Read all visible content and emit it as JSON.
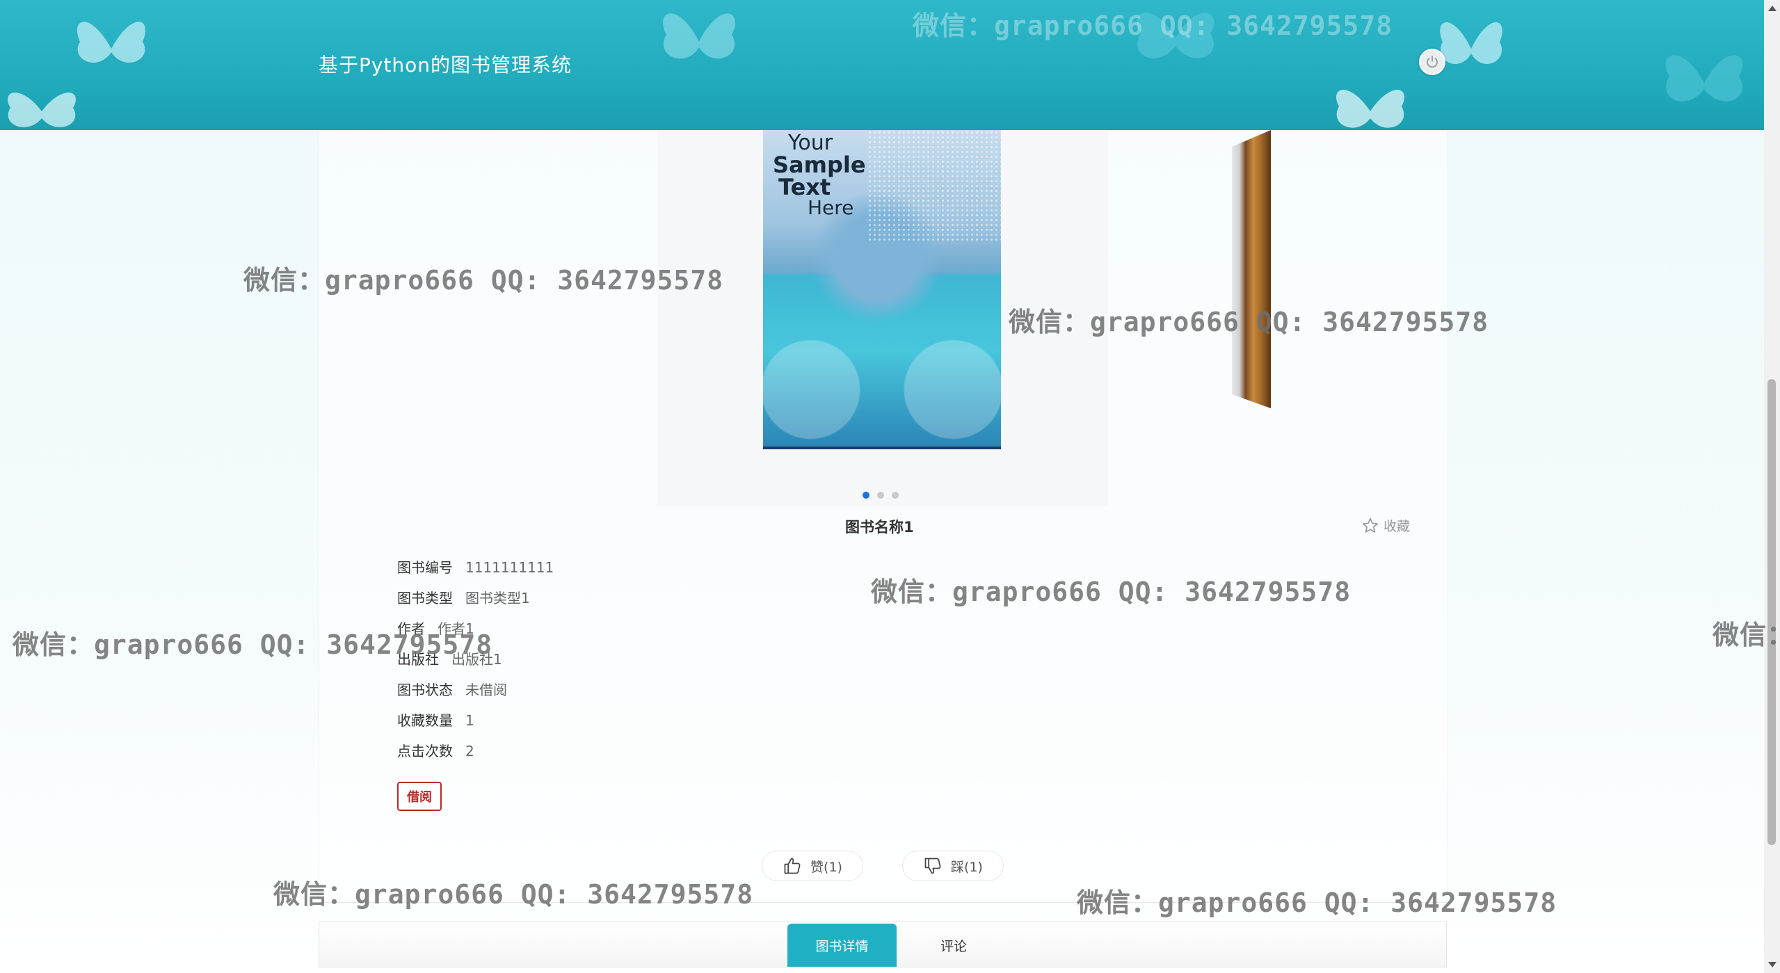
{
  "header": {
    "title": "基于Python的图书管理系统"
  },
  "colors": {
    "header_bg": "#1fa9bb",
    "active_tab": "#1fb0c4",
    "borrow_btn": "#b72a2a",
    "carousel_active_dot": "#1e6fe0"
  },
  "carousel": {
    "cover_text": [
      "Your",
      "Sample",
      "Text",
      "Here"
    ],
    "slide_count": 3,
    "active_index": 0
  },
  "book": {
    "title": "图书名称1",
    "favorite_label": "收藏",
    "fields": [
      {
        "label": "图书编号",
        "value": "1111111111"
      },
      {
        "label": "图书类型",
        "value": "图书类型1"
      },
      {
        "label": "作者",
        "value": "作者1"
      },
      {
        "label": "出版社",
        "value": "出版社1"
      },
      {
        "label": "图书状态",
        "value": "未借阅"
      },
      {
        "label": "收藏数量",
        "value": "1"
      },
      {
        "label": "点击次数",
        "value": "2"
      }
    ],
    "borrow_label": "借阅"
  },
  "votes": {
    "like_label": "赞(1)",
    "dislike_label": "踩(1)"
  },
  "tabs": [
    {
      "label": "图书详情",
      "active": true
    },
    {
      "label": "评论",
      "active": false
    }
  ],
  "watermark": {
    "text": "微信：grapro666 QQ: 3642795578",
    "partial": "微信："
  },
  "icons": {
    "power": "power-icon",
    "favorite": "star-outline-icon",
    "like": "thumbs-up-icon",
    "dislike": "thumbs-down-icon"
  }
}
